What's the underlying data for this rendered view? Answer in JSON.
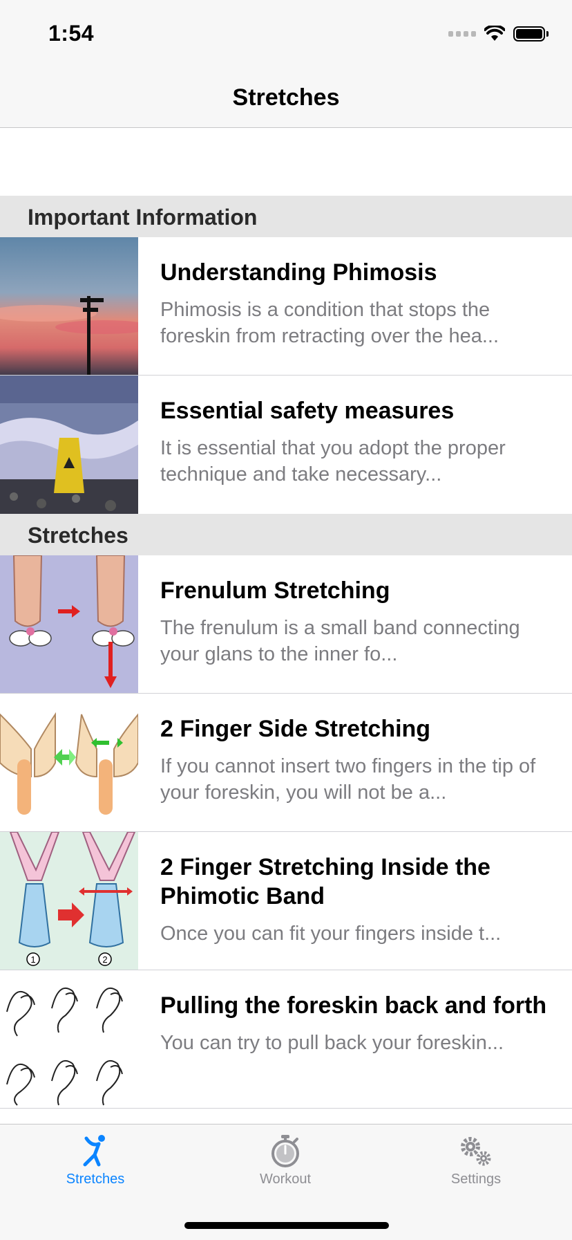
{
  "status_bar": {
    "time": "1:54"
  },
  "nav": {
    "title": "Stretches"
  },
  "sections": [
    {
      "header": "Important Information",
      "rows": [
        {
          "title": "Understanding Phimosis",
          "subtitle": "Phimosis is a condition that stops the foreskin from retracting over the hea..."
        },
        {
          "title": "Essential safety measures",
          "subtitle": "It is essential that you adopt the proper technique and take necessary..."
        }
      ]
    },
    {
      "header": "Stretches",
      "rows": [
        {
          "title": "Frenulum Stretching",
          "subtitle": "The frenulum is a small band connecting your glans to the inner fo..."
        },
        {
          "title": "2 Finger Side Stretching",
          "subtitle": "If you cannot insert two fingers in the tip of your foreskin, you will not be a..."
        },
        {
          "title": "2 Finger Stretching Inside the Phimotic Band",
          "subtitle": "Once you can fit your fingers inside t..."
        },
        {
          "title": "Pulling the foreskin back and forth",
          "subtitle": "You can try to pull back your foreskin..."
        }
      ]
    }
  ],
  "tabs": [
    {
      "label": "Stretches",
      "icon": "stretch-figure-icon",
      "active": true
    },
    {
      "label": "Workout",
      "icon": "stopwatch-icon",
      "active": false
    },
    {
      "label": "Settings",
      "icon": "gears-icon",
      "active": false
    }
  ],
  "colors": {
    "accent": "#0a84ff",
    "inactive": "#8e8e93",
    "section_bg": "#e5e5e5"
  }
}
